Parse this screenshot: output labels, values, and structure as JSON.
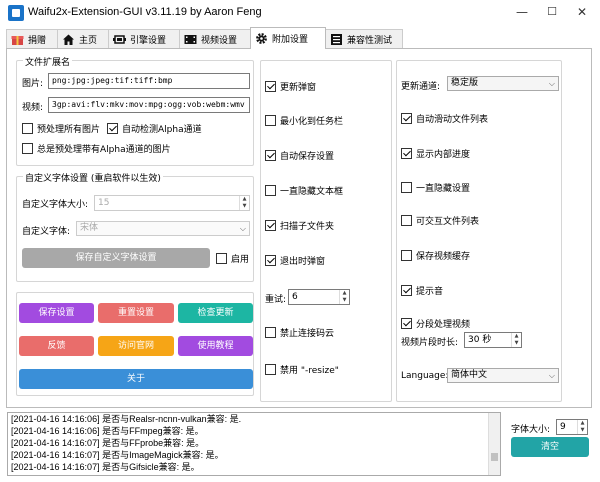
{
  "window": {
    "title": "Waifu2x-Extension-GUI v3.11.19 by Aaron Feng",
    "minimize": "—",
    "maximize": "☐",
    "close": "✕"
  },
  "tabs": [
    {
      "label": "捐赠",
      "icon": "gift-icon"
    },
    {
      "label": "主页",
      "icon": "home-icon"
    },
    {
      "label": "引擎设置",
      "icon": "engine-icon"
    },
    {
      "label": "视频设置",
      "icon": "video-icon"
    },
    {
      "label": "附加设置",
      "icon": "gear-icon",
      "active": true
    },
    {
      "label": "兼容性测试",
      "icon": "list-icon"
    }
  ],
  "file_ext": {
    "title": "文件扩展名",
    "image_label": "图片:",
    "image_value": "png:jpg:jpeg:tif:tiff:bmp",
    "video_label": "视频:",
    "video_value": "3gp:avi:flv:mkv:mov:mpg:ogg:vob:webm:wmv",
    "preprocess_all": "预处理所有图片",
    "auto_alpha": "自动检测Alpha通道",
    "preprocess_alpha": "总是预处理带有Alpha通道的图片"
  },
  "font": {
    "title": "自定义字体设置 (重启软件以生效)",
    "size_label": "自定义字体大小:",
    "size_value": "15",
    "font_label": "自定义字体:",
    "font_value": "宋体",
    "save_btn": "保存自定义字体设置",
    "enable": "启用"
  },
  "buttons": {
    "save": "保存设置",
    "reset": "重置设置",
    "update": "检查更新",
    "feedback": "反馈",
    "website": "访问官网",
    "tutorial": "使用教程",
    "about": "关于"
  },
  "colors": {
    "purple": "#a24be0",
    "red": "#e96d6b",
    "teal": "#1db6a3",
    "orange": "#f6a516",
    "blue": "#3a8fd8",
    "clear": "#22a4a6"
  },
  "options_mid": {
    "update_popup": "更新弹窗",
    "minimize_tray": "最小化到任务栏",
    "autosave": "自动保存设置",
    "hide_textbox": "一直隐藏文本框",
    "scan_subfolders": "扫描子文件夹",
    "exit_popup": "退出时弹窗",
    "retry_label": "重试:",
    "retry_value": "6",
    "no_connect_cloud": "禁止连接码云",
    "disable_resize": "禁用 \"-resize\""
  },
  "options_right": {
    "update_channel_label": "更新通道:",
    "update_channel_value": "稳定版",
    "auto_scroll": "自动滑动文件列表",
    "show_progress": "显示内部进度",
    "hide_settings": "一直隐藏设置",
    "interactive_list": "可交互文件列表",
    "keep_video_cache": "保存视频缓存",
    "prompt_sound": "提示音",
    "segment_video": "分段处理视频",
    "segment_label": "视频片段时长:",
    "segment_value": "30 秒",
    "language_label": "Language:",
    "language_value": "简体中文"
  },
  "log": [
    "[2021-04-16 14:16:06] 是否与Realsr-ncnn-vulkan兼容: 是.",
    "[2021-04-16 14:16:06] 是否与FFmpeg兼容: 是。",
    "[2021-04-16 14:16:07] 是否与FFprobe兼容: 是。",
    "[2021-04-16 14:16:07] 是否与ImageMagick兼容: 是。",
    "[2021-04-16 14:16:07] 是否与Gifsicle兼容: 是。"
  ],
  "bottom_right": {
    "font_size_label": "字体大小:",
    "font_size_value": "9",
    "clear_btn": "清空"
  }
}
